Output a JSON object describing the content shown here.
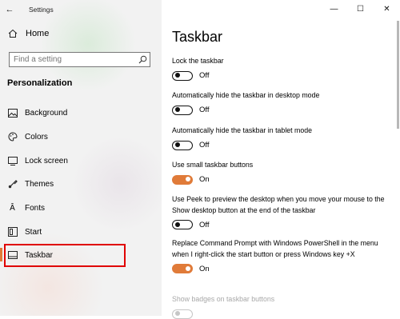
{
  "window": {
    "title": "Settings",
    "controls": [
      "—",
      "☐",
      "✕"
    ]
  },
  "sidebar": {
    "home_label": "Home",
    "search_placeholder": "Find a setting",
    "section_title": "Personalization",
    "items": [
      {
        "label": "Background",
        "icon": "image-icon"
      },
      {
        "label": "Colors",
        "icon": "palette-icon"
      },
      {
        "label": "Lock screen",
        "icon": "lock-screen-icon"
      },
      {
        "label": "Themes",
        "icon": "themes-icon"
      },
      {
        "label": "Fonts",
        "icon": "fonts-icon"
      },
      {
        "label": "Start",
        "icon": "start-icon"
      },
      {
        "label": "Taskbar",
        "icon": "taskbar-icon",
        "selected": true
      }
    ]
  },
  "main": {
    "title": "Taskbar",
    "settings": [
      {
        "label": "Lock the taskbar",
        "state": "Off"
      },
      {
        "label": "Automatically hide the taskbar in desktop mode",
        "state": "Off"
      },
      {
        "label": "Automatically hide the taskbar in tablet mode",
        "state": "Off"
      },
      {
        "label": "Use small taskbar buttons",
        "state": "On"
      },
      {
        "label": "Use Peek to preview the desktop when you move your mouse to the Show desktop button at the end of the taskbar",
        "state": "Off"
      },
      {
        "label": "Replace Command Prompt with Windows PowerShell in the menu when I right-click the start button or press Windows key +X",
        "state": "On"
      },
      {
        "label": "Show badges on taskbar buttons",
        "state": ""
      }
    ]
  },
  "colors": {
    "accent": "#e07b39",
    "highlight": "#e00000"
  }
}
